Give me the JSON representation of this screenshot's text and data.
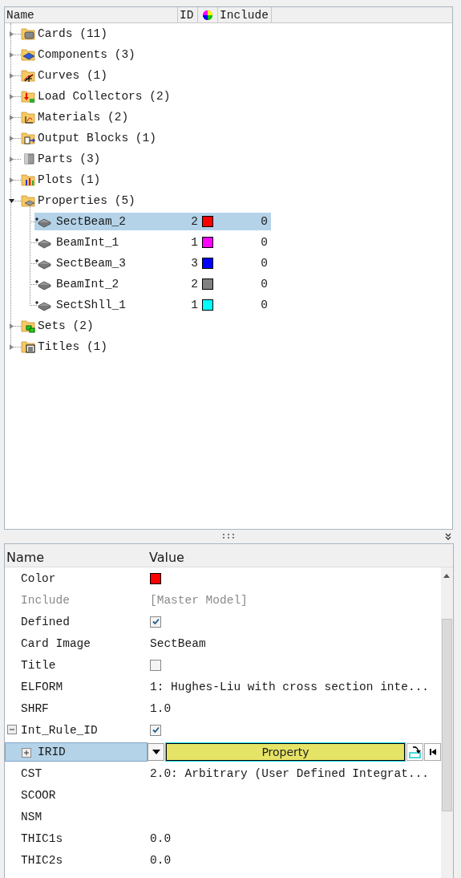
{
  "tree": {
    "columns": [
      "Name",
      "ID",
      "Include"
    ],
    "items": [
      {
        "kind": "cards",
        "label": "Cards (11)",
        "expanded": false
      },
      {
        "kind": "components",
        "label": "Components (3)",
        "expanded": false
      },
      {
        "kind": "curves",
        "label": "Curves (1)",
        "expanded": false
      },
      {
        "kind": "loads",
        "label": "Load Collectors (2)",
        "expanded": false
      },
      {
        "kind": "materials",
        "label": "Materials (2)",
        "expanded": false
      },
      {
        "kind": "output",
        "label": "Output Blocks (1)",
        "expanded": false
      },
      {
        "kind": "parts",
        "label": "Parts (3)",
        "expanded": false
      },
      {
        "kind": "plots",
        "label": "Plots (1)",
        "expanded": false
      },
      {
        "kind": "properties",
        "label": "Properties (5)",
        "expanded": true,
        "children": [
          {
            "label": "SectBeam_2",
            "id": "2",
            "color": "#ff0000",
            "include": "0",
            "selected": true
          },
          {
            "label": "BeamInt_1",
            "id": "1",
            "color": "#ff00ff",
            "include": "0",
            "selected": false
          },
          {
            "label": "SectBeam_3",
            "id": "3",
            "color": "#0000ff",
            "include": "0",
            "selected": false
          },
          {
            "label": "BeamInt_2",
            "id": "2",
            "color": "#808080",
            "include": "0",
            "selected": false
          },
          {
            "label": "SectShll_1",
            "id": "1",
            "color": "#00ffff",
            "include": "0",
            "selected": false
          }
        ]
      },
      {
        "kind": "sets",
        "label": "Sets (2)",
        "expanded": false
      },
      {
        "kind": "titles",
        "label": "Titles (1)",
        "expanded": false
      }
    ]
  },
  "properties": {
    "columns": [
      "Name",
      "Value"
    ],
    "rows": [
      {
        "kind": "color",
        "name": "Color",
        "color": "#ff0000",
        "disabled": false
      },
      {
        "kind": "text",
        "name": "Include",
        "value": "[Master Model]",
        "disabled": true
      },
      {
        "kind": "checkbox",
        "name": "Defined",
        "checked": true,
        "disabled": false
      },
      {
        "kind": "text",
        "name": "Card Image",
        "value": "SectBeam",
        "disabled": false
      },
      {
        "kind": "checkbox",
        "name": "Title",
        "checked": false,
        "disabled": false
      },
      {
        "kind": "text",
        "name": "ELFORM",
        "value": "1: Hughes-Liu with cross section inte...",
        "disabled": false
      },
      {
        "kind": "text",
        "name": "SHRF",
        "value": "1.0",
        "disabled": false
      },
      {
        "kind": "checkbox",
        "name": "Int_Rule_ID",
        "checked": true,
        "disabled": false,
        "expanded": true,
        "children": [
          {
            "kind": "reference",
            "name": "IRID",
            "value": "Property",
            "expanded": false,
            "selected": true
          }
        ]
      },
      {
        "kind": "text",
        "name": "CST",
        "value": "2.0: Arbitrary (User Defined Integrat...",
        "disabled": false
      },
      {
        "kind": "text",
        "name": "SCOOR",
        "disabled": false
      },
      {
        "kind": "text",
        "name": "NSM",
        "disabled": false
      },
      {
        "kind": "text",
        "name": "THIC1s",
        "value": "0.0",
        "disabled": false
      },
      {
        "kind": "text",
        "name": "THIC2s",
        "value": "0.0",
        "disabled": false
      }
    ]
  }
}
